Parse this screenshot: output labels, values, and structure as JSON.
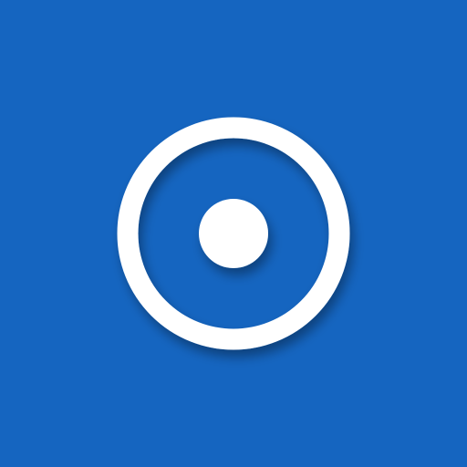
{
  "icon": {
    "name": "record-icon",
    "background_color": "#1565C0",
    "foreground_color": "#FFFFFF",
    "shadow_color": "#0D3F80"
  }
}
